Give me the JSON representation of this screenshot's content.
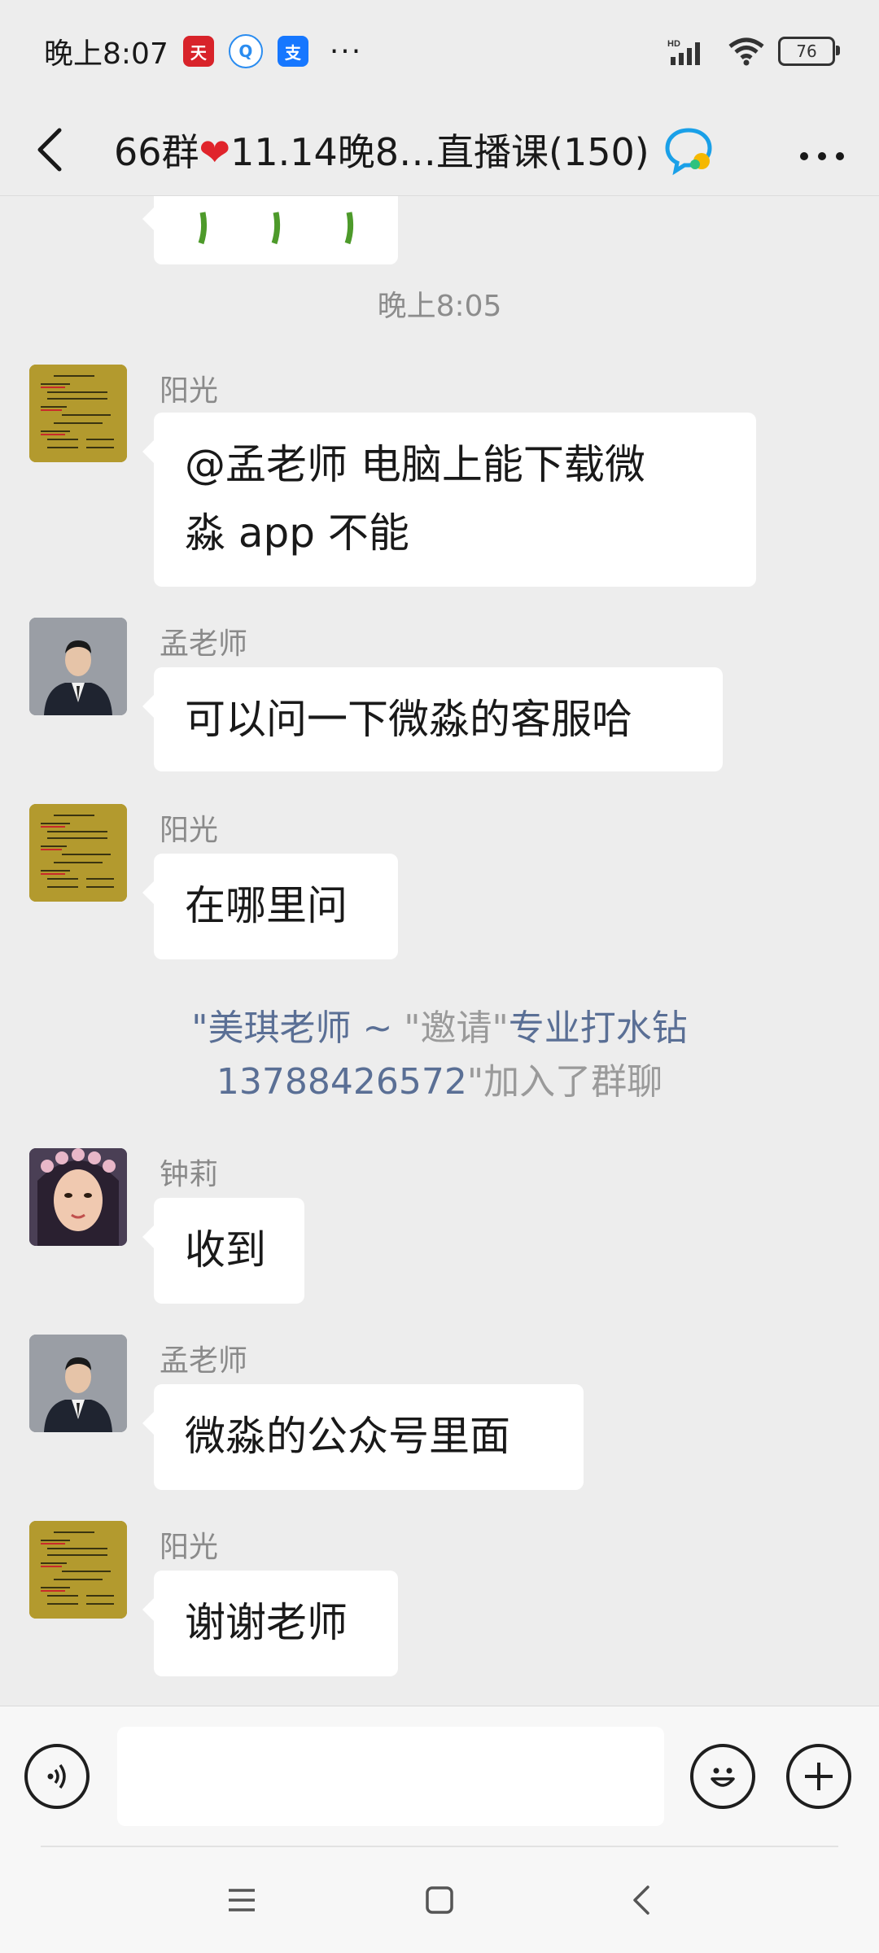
{
  "status_bar": {
    "time": "晚上8:07",
    "dots": "···",
    "battery": "76",
    "network_badge": "HD"
  },
  "header": {
    "title_prefix": "66群",
    "title_suffix": "11.14晚8…直播课(150)"
  },
  "messages": [
    {
      "type": "time",
      "text": "晚上8:05"
    },
    {
      "type": "msg",
      "sender": "阳光",
      "lines": [
        "@孟老师  电脑上能下载微",
        "淼 app 不能"
      ]
    },
    {
      "type": "msg",
      "sender": "孟老师",
      "lines": [
        "可以问一下微淼的客服哈"
      ]
    },
    {
      "type": "msg",
      "sender": "阳光",
      "lines": [
        "在哪里问"
      ]
    },
    {
      "type": "system",
      "line1_name1": "\"美琪老师 ~",
      "line1_mid": " \"邀请\"",
      "line1_name2": "专业打水钻",
      "line2_name": "13788426572",
      "line2_rest": "\"加入了群聊"
    },
    {
      "type": "msg",
      "sender": "钟莉",
      "lines": [
        "收到"
      ]
    },
    {
      "type": "msg",
      "sender": "孟老师",
      "lines": [
        "微淼的公众号里面"
      ]
    },
    {
      "type": "msg",
      "sender": "阳光",
      "lines": [
        "谢谢老师"
      ]
    }
  ],
  "input": {
    "value": "",
    "placeholder": ""
  },
  "colors": {
    "background": "#ededed",
    "bubble": "#ffffff",
    "system_name": "#5a6f95",
    "heart": "#e0242b"
  },
  "icons": [
    "back-arrow-icon",
    "heart-icon",
    "group-chat-icon",
    "more-icon",
    "voice-icon",
    "emoji-icon",
    "plus-icon",
    "menu-icon",
    "home-icon",
    "back-icon"
  ]
}
